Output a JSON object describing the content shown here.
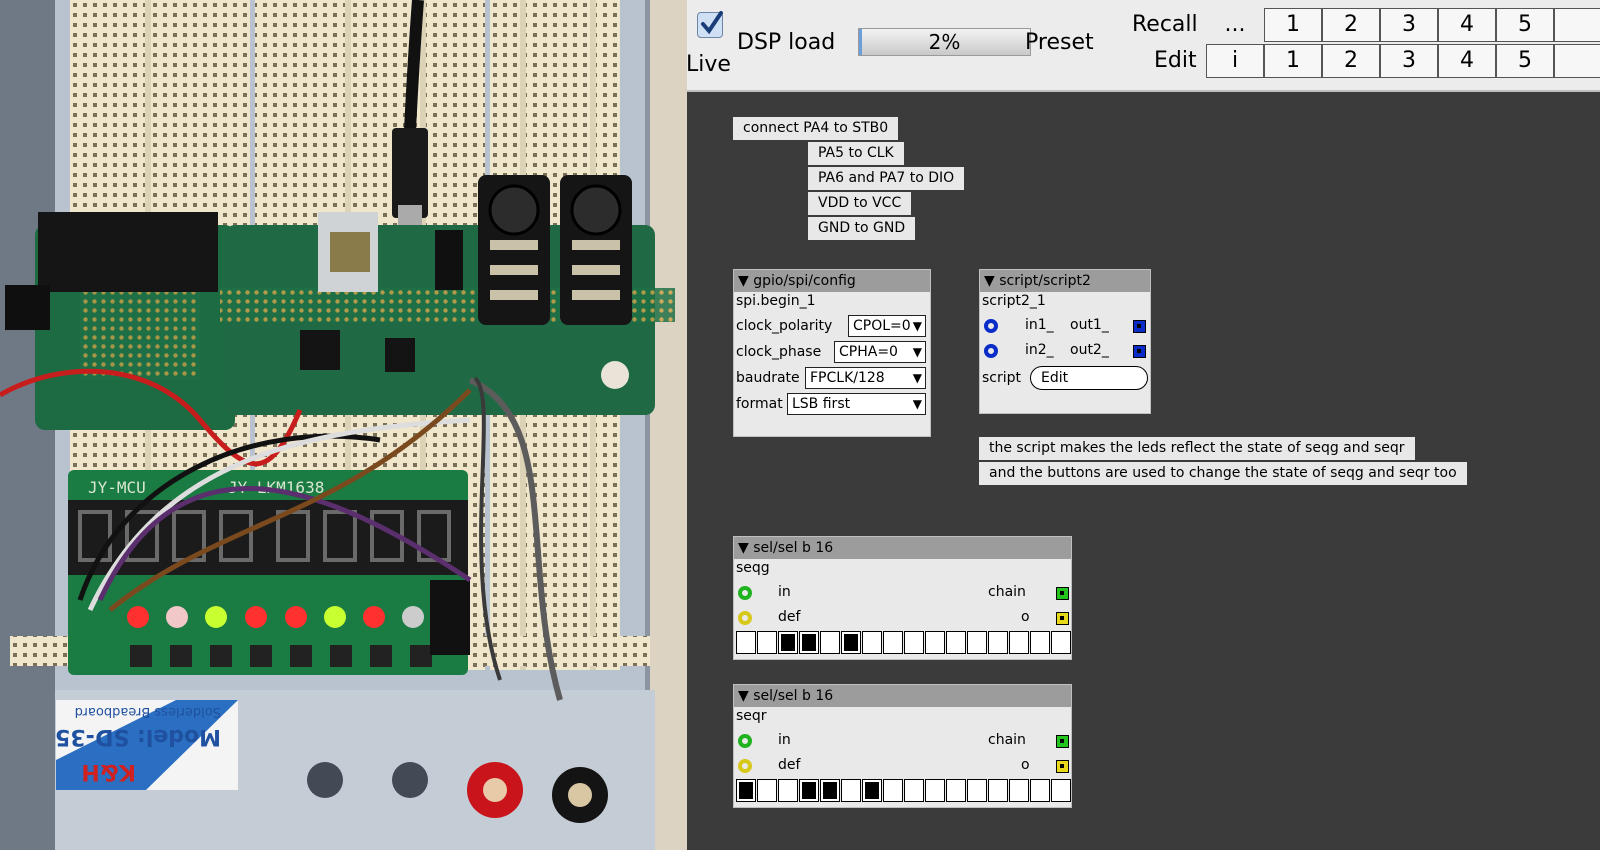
{
  "toolbar": {
    "live_label": "Live",
    "live_checked": true,
    "dsp_label": "DSP load",
    "dsp_value": "2%",
    "dsp_fraction": 0.02,
    "preset_label": "Preset",
    "recall_label": "Recall",
    "recall_more": "...",
    "edit_label": "Edit",
    "edit_info": "i",
    "preset_numbers": [
      "1",
      "2",
      "3",
      "4",
      "5"
    ]
  },
  "comments": {
    "c1": "connect PA4 to STB0",
    "c2": "PA5 to CLK",
    "c3": "PA6 and PA7 to DIO",
    "c4": "VDD to VCC",
    "c5": "GND to GND",
    "c6": "the script makes the leds reflect the state of seqg and seqr",
    "c7": "and the buttons are used to change the state of seqg and seqr too"
  },
  "spi": {
    "title": "gpio/spi/config",
    "instance": "spi.begin_1",
    "clock_polarity_label": "clock_polarity",
    "clock_polarity_value": "CPOL=0",
    "clock_phase_label": "clock_phase",
    "clock_phase_value": "CPHA=0",
    "baudrate_label": "baudrate",
    "baudrate_value": "FPCLK/128",
    "format_label": "format",
    "format_value": "LSB first"
  },
  "script": {
    "title": "script/script2",
    "instance": "script2_1",
    "in1": "in1_",
    "out1": "out1_",
    "in2": "in2_",
    "out2": "out2_",
    "script_label": "script",
    "edit_label": "Edit"
  },
  "sel1": {
    "title": "sel/sel b 16",
    "instance": "seqg",
    "in_label": "in",
    "def_label": "def",
    "chain_label": "chain",
    "o_label": "o",
    "cells": [
      0,
      0,
      1,
      1,
      0,
      1,
      0,
      0,
      0,
      0,
      0,
      0,
      0,
      0,
      0,
      0
    ]
  },
  "sel2": {
    "title": "sel/sel b 16",
    "instance": "seqr",
    "in_label": "in",
    "def_label": "def",
    "chain_label": "chain",
    "o_label": "o",
    "cells": [
      1,
      0,
      0,
      1,
      1,
      0,
      1,
      0,
      0,
      0,
      0,
      0,
      0,
      0,
      0,
      0
    ]
  },
  "photo": {
    "display_top": "JY-MCU",
    "display_model": "JY-LKM1638",
    "breadboard_brand": "K&H",
    "breadboard_model": "Model: SD-35",
    "breadboard_sub": "Solderless Breadboard",
    "led_colors": [
      "#ff3030",
      "#f2c7c7",
      "#c8ff30",
      "#ff3030",
      "#ff3030",
      "#c8ff30",
      "#ff3030",
      "#cccccc"
    ]
  }
}
